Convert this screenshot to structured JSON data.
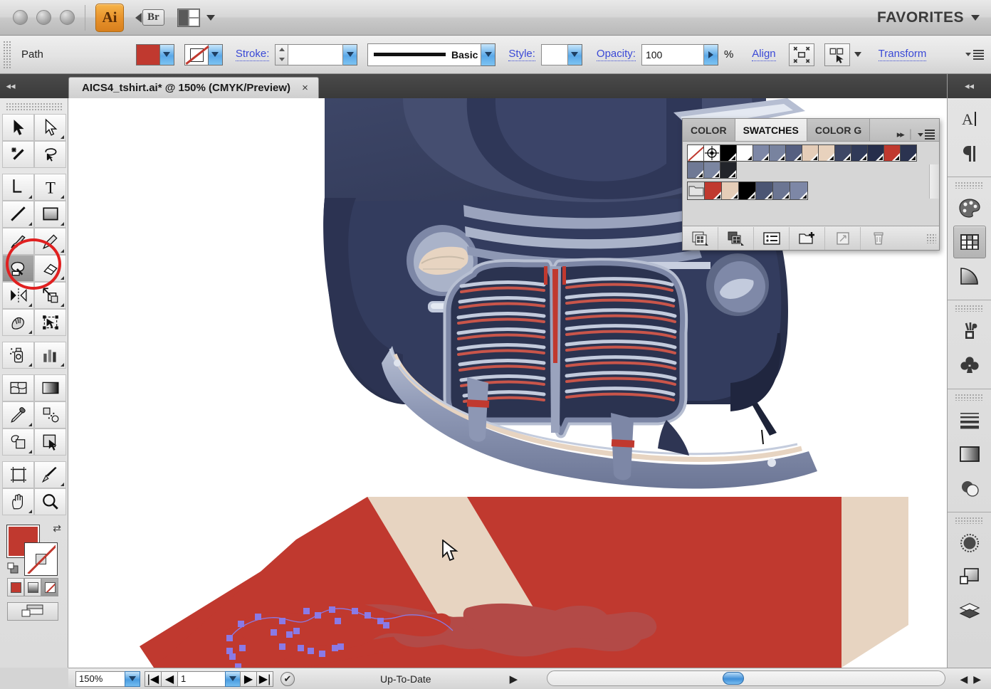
{
  "app": {
    "name_badge": "Ai",
    "bridge_badge": "Br",
    "favorites_label": "FAVORITES",
    "traffic_buttons": [
      "close",
      "minimize",
      "zoom"
    ]
  },
  "control_bar": {
    "context_label": "Path",
    "fill_label": "fill-swatch",
    "fill_color": "#c0392f",
    "stroke_swatch_label": "stroke-swatch",
    "stroke_color": "none",
    "stroke_label": "Stroke:",
    "stroke_weight_value": "",
    "stroke_profile_label": "Basic",
    "style_label": "Style:",
    "style_value": "",
    "opacity_label": "Opacity:",
    "opacity_value": "100",
    "opacity_unit": "%",
    "align_label": "Align",
    "transform_label": "Transform"
  },
  "document_tab": {
    "title": "AICS4_tshirt.ai* @ 150% (CMYK/Preview)",
    "close_glyph": "×"
  },
  "toolbox": {
    "rows": [
      [
        {
          "name": "selection-tool",
          "icon": "arrow",
          "selected": false,
          "menu": false
        },
        {
          "name": "direct-selection-tool",
          "icon": "arrow-hollow",
          "selected": false,
          "menu": true
        }
      ],
      [
        {
          "name": "magic-wand-tool",
          "icon": "wand",
          "selected": false,
          "menu": false
        },
        {
          "name": "lasso-tool",
          "icon": "lasso",
          "selected": false,
          "menu": false
        }
      ],
      [
        {
          "name": "pen-tool",
          "icon": "pen",
          "selected": false,
          "menu": true
        },
        {
          "name": "type-tool",
          "icon": "type-T",
          "selected": false,
          "menu": true
        }
      ],
      [
        {
          "name": "line-segment-tool",
          "icon": "line",
          "selected": false,
          "menu": true
        },
        {
          "name": "rectangle-tool",
          "icon": "rectangle",
          "selected": false,
          "menu": true
        }
      ],
      [
        {
          "name": "paintbrush-tool",
          "icon": "paintbrush",
          "selected": false,
          "menu": false
        },
        {
          "name": "pencil-tool",
          "icon": "pencil",
          "selected": false,
          "menu": true
        }
      ],
      [
        {
          "name": "blob-brush-tool",
          "icon": "blob-brush",
          "selected": true,
          "menu": false
        },
        {
          "name": "eraser-tool",
          "icon": "eraser",
          "selected": false,
          "menu": true
        }
      ],
      [
        {
          "name": "rotate-tool",
          "icon": "rotate-reflect",
          "selected": false,
          "menu": true
        },
        {
          "name": "scale-tool",
          "icon": "scale",
          "selected": false,
          "menu": true
        }
      ],
      [
        {
          "name": "warp-tool",
          "icon": "warp-hand",
          "selected": false,
          "menu": true
        },
        {
          "name": "free-transform-tool",
          "icon": "free-transform",
          "selected": false,
          "menu": false
        }
      ],
      [
        {
          "name": "symbol-sprayer-tool",
          "icon": "symbol-sprayer",
          "selected": false,
          "menu": true
        },
        {
          "name": "column-graph-tool",
          "icon": "bar-graph",
          "selected": false,
          "menu": true
        }
      ],
      [
        {
          "name": "mesh-tool",
          "icon": "mesh",
          "selected": false,
          "menu": false
        },
        {
          "name": "gradient-tool",
          "icon": "gradient",
          "selected": false,
          "menu": false
        }
      ],
      [
        {
          "name": "eyedropper-tool",
          "icon": "eyedropper",
          "selected": false,
          "menu": true
        },
        {
          "name": "blend-tool",
          "icon": "blend",
          "selected": false,
          "menu": false
        }
      ],
      [
        {
          "name": "live-paint-bucket-tool",
          "icon": "live-paint-bucket",
          "selected": false,
          "menu": true
        },
        {
          "name": "live-paint-selection-tool",
          "icon": "live-paint-selection",
          "selected": false,
          "menu": false
        }
      ],
      [
        {
          "name": "artboard-tool",
          "icon": "artboard",
          "selected": false,
          "menu": false
        },
        {
          "name": "slice-tool",
          "icon": "slice-knife",
          "selected": false,
          "menu": true
        }
      ],
      [
        {
          "name": "hand-tool",
          "icon": "hand",
          "selected": false,
          "menu": true
        },
        {
          "name": "zoom-tool",
          "icon": "magnifier",
          "selected": false,
          "menu": false
        }
      ]
    ],
    "highlighted_tool": "blob-brush-tool",
    "fill_color": "#c0392f",
    "stroke_color": "none",
    "paint_modes": [
      {
        "name": "color-mode",
        "active": false
      },
      {
        "name": "gradient-mode",
        "active": false
      },
      {
        "name": "none-mode",
        "active": true
      }
    ],
    "screen_mode": "normal-screen-mode"
  },
  "swatches_panel": {
    "tabs": [
      {
        "label": "COLOR",
        "active": false
      },
      {
        "label": "SWATCHES",
        "active": true
      },
      {
        "label": "COLOR G",
        "active": false
      }
    ],
    "collapse_glyph": "▸▸",
    "row1": [
      {
        "name": "swatch-none",
        "color": "none",
        "kind": "none"
      },
      {
        "name": "swatch-registration",
        "color": "#1a1a1a",
        "kind": "registration"
      },
      {
        "name": "swatch-black",
        "color": "#000000",
        "kind": "global"
      },
      {
        "name": "swatch-white",
        "color": "#ffffff",
        "kind": "global"
      },
      {
        "name": "swatch-slate-blue",
        "color": "#7d87a6",
        "kind": "global"
      },
      {
        "name": "swatch-slate-blue-2",
        "color": "#78839f",
        "kind": "global"
      },
      {
        "name": "swatch-navy-mid",
        "color": "#555f80",
        "kind": "global"
      },
      {
        "name": "swatch-sand",
        "color": "#e5cdb8",
        "kind": "global"
      },
      {
        "name": "swatch-sand-light",
        "color": "#e8d2bd",
        "kind": "global"
      },
      {
        "name": "swatch-navy-dark",
        "color": "#3e4765",
        "kind": "global"
      },
      {
        "name": "swatch-navy-darker",
        "color": "#303a58",
        "kind": "global"
      },
      {
        "name": "swatch-navy-deep",
        "color": "#262e4b",
        "kind": "global"
      },
      {
        "name": "swatch-red",
        "color": "#c0392f",
        "kind": "global"
      },
      {
        "name": "swatch-navy-deep-2",
        "color": "#2b3350",
        "kind": "global"
      }
    ],
    "row2": [
      {
        "name": "swatch-grayblue",
        "color": "#6f7995",
        "kind": "global"
      },
      {
        "name": "swatch-grayblue-2",
        "color": "#7b86a1",
        "kind": "global"
      },
      {
        "name": "swatch-near-black",
        "color": "#22242a",
        "kind": "global"
      }
    ],
    "row3": [
      {
        "name": "swatch-folder",
        "color": "#d6d6d6",
        "kind": "folder"
      },
      {
        "name": "swatch-group-red",
        "color": "#c0392f",
        "kind": "global"
      },
      {
        "name": "swatch-group-sand",
        "color": "#e5cdb8",
        "kind": "global"
      },
      {
        "name": "swatch-group-black",
        "color": "#000000",
        "kind": "global"
      },
      {
        "name": "swatch-group-navy",
        "color": "#4b5573",
        "kind": "global"
      },
      {
        "name": "swatch-group-slate",
        "color": "#6b7592",
        "kind": "global"
      },
      {
        "name": "swatch-group-slate-2",
        "color": "#7d87a6",
        "kind": "global"
      }
    ],
    "footer_buttons": [
      {
        "name": "swatch-libraries-menu-button"
      },
      {
        "name": "show-swatch-kinds-menu-button"
      },
      {
        "name": "swatch-options-button"
      },
      {
        "name": "new-color-group-button"
      },
      {
        "name": "new-swatch-button"
      },
      {
        "name": "delete-swatch-button"
      }
    ]
  },
  "right_dock": {
    "groups": [
      {
        "items": [
          {
            "name": "character-panel-icon",
            "glyph": "A|",
            "active": false
          },
          {
            "name": "paragraph-panel-icon",
            "glyph": "¶",
            "active": false
          }
        ]
      },
      {
        "items": [
          {
            "name": "color-panel-icon",
            "glyph": "palette",
            "active": false
          },
          {
            "name": "swatches-panel-icon",
            "glyph": "swatch-grid",
            "active": true
          },
          {
            "name": "gradient-panel-icon",
            "glyph": "gradient-wedge",
            "active": false
          }
        ]
      },
      {
        "items": [
          {
            "name": "brushes-panel-icon",
            "glyph": "brush-cup",
            "active": false
          },
          {
            "name": "symbols-panel-icon",
            "glyph": "club",
            "active": false
          }
        ]
      },
      {
        "items": [
          {
            "name": "stroke-panel-icon",
            "glyph": "stroke-lines",
            "active": false
          },
          {
            "name": "gradient-swatch-icon",
            "glyph": "gradient-box",
            "active": false
          },
          {
            "name": "transparency-panel-icon",
            "glyph": "two-circles",
            "active": false
          }
        ]
      },
      {
        "items": [
          {
            "name": "appearance-panel-icon",
            "glyph": "dotted-circle",
            "active": false
          },
          {
            "name": "graphic-styles-panel-icon",
            "glyph": "stacked-squares",
            "active": false
          },
          {
            "name": "layers-panel-icon",
            "glyph": "layers-diamond",
            "active": false
          }
        ]
      }
    ]
  },
  "status_bar": {
    "zoom_value": "150%",
    "page_value": "1",
    "status_text": "Up-To-Date",
    "first_page_glyph": "|◀",
    "prev_page_glyph": "◀",
    "next_page_glyph": "▶",
    "last_page_glyph": "▶|",
    "status_check_glyph": "✔",
    "status_menu_glyph": "▶"
  },
  "artwork": {
    "description": "vintage car front with grille, bumper and headlights over red and cream diagonal stripes",
    "colors": {
      "body_navy_dark": "#2e3553",
      "body_navy": "#3c4566",
      "body_navy_light": "#4d5676",
      "chrome_slate": "#8f99b5",
      "chrome_light": "#b3bcd2",
      "cream": "#e7d4c1",
      "red": "#c0392f",
      "red_brush": "#b34a47",
      "grille_dark": "#2b3350",
      "grille_red": "#c9554a",
      "anchor_point": "#8a7ae6"
    }
  }
}
